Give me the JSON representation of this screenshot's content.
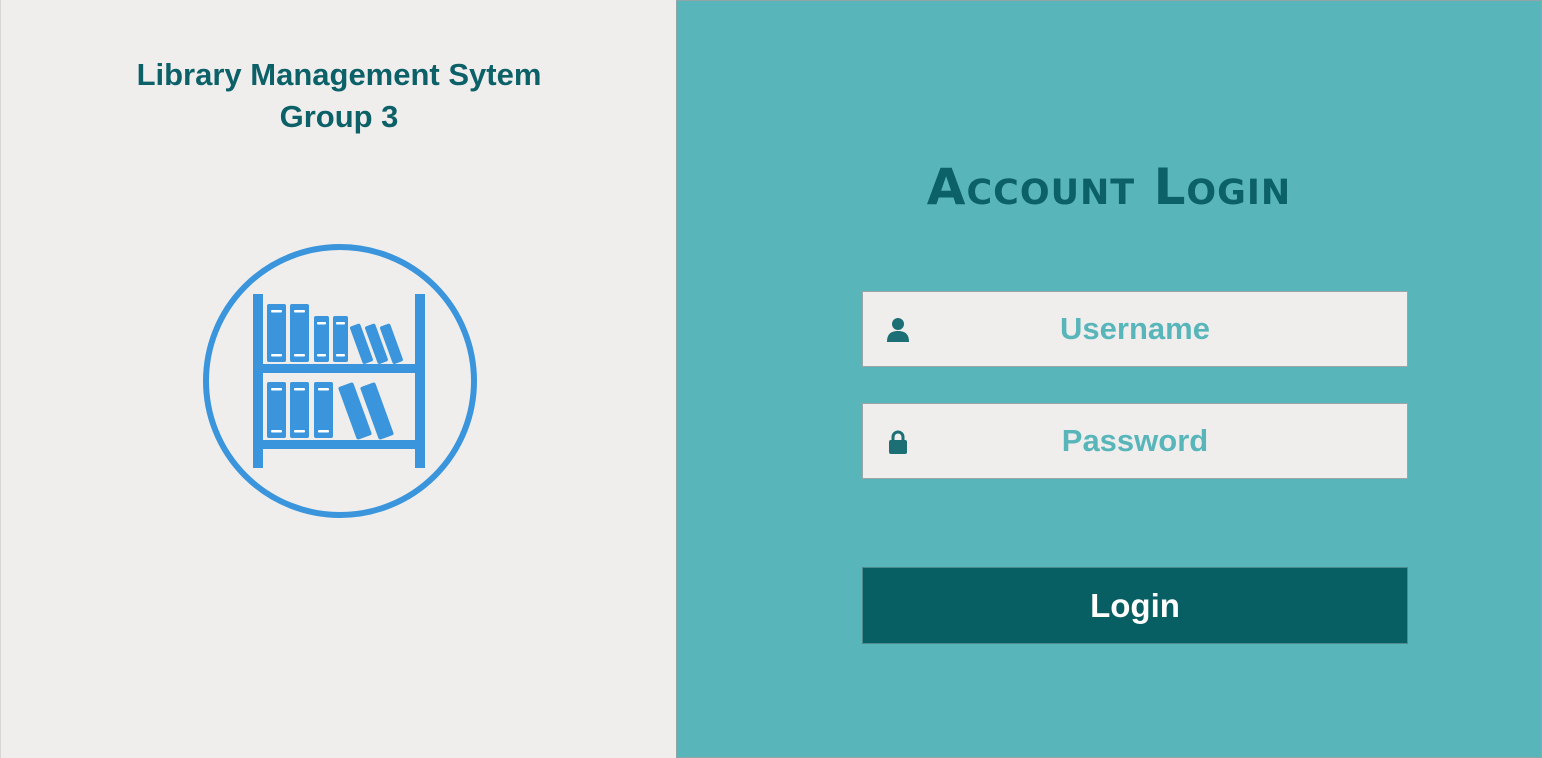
{
  "app": {
    "title_line1": "Library Management Sytem",
    "title_line2": "Group 3",
    "logo_icon": "bookshelf-icon"
  },
  "login": {
    "heading": "Account Login",
    "username": {
      "placeholder": "Username",
      "value": "",
      "icon": "user-icon"
    },
    "password": {
      "placeholder": "Password",
      "value": "",
      "icon": "lock-icon"
    },
    "button_label": "Login"
  },
  "colors": {
    "left_background": "#efeeed",
    "right_background": "#58b6ba",
    "title_text": "#0c6168",
    "logo_blue": "#3a95dc",
    "input_text": "#58b6ba",
    "button_background": "#075f63",
    "button_text": "#ffffff"
  }
}
